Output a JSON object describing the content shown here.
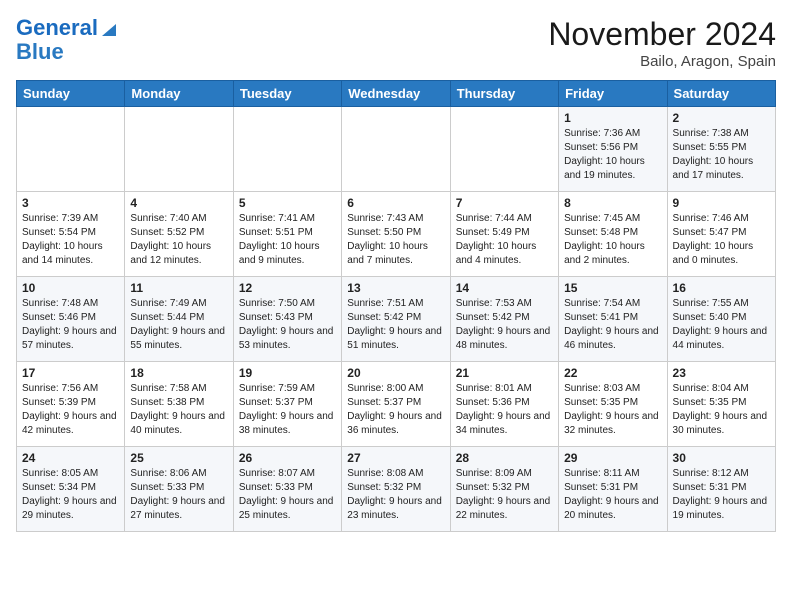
{
  "header": {
    "logo_line1": "General",
    "logo_line2": "Blue",
    "month_title": "November 2024",
    "location": "Bailo, Aragon, Spain"
  },
  "weekdays": [
    "Sunday",
    "Monday",
    "Tuesday",
    "Wednesday",
    "Thursday",
    "Friday",
    "Saturday"
  ],
  "weeks": [
    [
      {
        "day": "",
        "info": ""
      },
      {
        "day": "",
        "info": ""
      },
      {
        "day": "",
        "info": ""
      },
      {
        "day": "",
        "info": ""
      },
      {
        "day": "",
        "info": ""
      },
      {
        "day": "1",
        "info": "Sunrise: 7:36 AM\nSunset: 5:56 PM\nDaylight: 10 hours and 19 minutes."
      },
      {
        "day": "2",
        "info": "Sunrise: 7:38 AM\nSunset: 5:55 PM\nDaylight: 10 hours and 17 minutes."
      }
    ],
    [
      {
        "day": "3",
        "info": "Sunrise: 7:39 AM\nSunset: 5:54 PM\nDaylight: 10 hours and 14 minutes."
      },
      {
        "day": "4",
        "info": "Sunrise: 7:40 AM\nSunset: 5:52 PM\nDaylight: 10 hours and 12 minutes."
      },
      {
        "day": "5",
        "info": "Sunrise: 7:41 AM\nSunset: 5:51 PM\nDaylight: 10 hours and 9 minutes."
      },
      {
        "day": "6",
        "info": "Sunrise: 7:43 AM\nSunset: 5:50 PM\nDaylight: 10 hours and 7 minutes."
      },
      {
        "day": "7",
        "info": "Sunrise: 7:44 AM\nSunset: 5:49 PM\nDaylight: 10 hours and 4 minutes."
      },
      {
        "day": "8",
        "info": "Sunrise: 7:45 AM\nSunset: 5:48 PM\nDaylight: 10 hours and 2 minutes."
      },
      {
        "day": "9",
        "info": "Sunrise: 7:46 AM\nSunset: 5:47 PM\nDaylight: 10 hours and 0 minutes."
      }
    ],
    [
      {
        "day": "10",
        "info": "Sunrise: 7:48 AM\nSunset: 5:46 PM\nDaylight: 9 hours and 57 minutes."
      },
      {
        "day": "11",
        "info": "Sunrise: 7:49 AM\nSunset: 5:44 PM\nDaylight: 9 hours and 55 minutes."
      },
      {
        "day": "12",
        "info": "Sunrise: 7:50 AM\nSunset: 5:43 PM\nDaylight: 9 hours and 53 minutes."
      },
      {
        "day": "13",
        "info": "Sunrise: 7:51 AM\nSunset: 5:42 PM\nDaylight: 9 hours and 51 minutes."
      },
      {
        "day": "14",
        "info": "Sunrise: 7:53 AM\nSunset: 5:42 PM\nDaylight: 9 hours and 48 minutes."
      },
      {
        "day": "15",
        "info": "Sunrise: 7:54 AM\nSunset: 5:41 PM\nDaylight: 9 hours and 46 minutes."
      },
      {
        "day": "16",
        "info": "Sunrise: 7:55 AM\nSunset: 5:40 PM\nDaylight: 9 hours and 44 minutes."
      }
    ],
    [
      {
        "day": "17",
        "info": "Sunrise: 7:56 AM\nSunset: 5:39 PM\nDaylight: 9 hours and 42 minutes."
      },
      {
        "day": "18",
        "info": "Sunrise: 7:58 AM\nSunset: 5:38 PM\nDaylight: 9 hours and 40 minutes."
      },
      {
        "day": "19",
        "info": "Sunrise: 7:59 AM\nSunset: 5:37 PM\nDaylight: 9 hours and 38 minutes."
      },
      {
        "day": "20",
        "info": "Sunrise: 8:00 AM\nSunset: 5:37 PM\nDaylight: 9 hours and 36 minutes."
      },
      {
        "day": "21",
        "info": "Sunrise: 8:01 AM\nSunset: 5:36 PM\nDaylight: 9 hours and 34 minutes."
      },
      {
        "day": "22",
        "info": "Sunrise: 8:03 AM\nSunset: 5:35 PM\nDaylight: 9 hours and 32 minutes."
      },
      {
        "day": "23",
        "info": "Sunrise: 8:04 AM\nSunset: 5:35 PM\nDaylight: 9 hours and 30 minutes."
      }
    ],
    [
      {
        "day": "24",
        "info": "Sunrise: 8:05 AM\nSunset: 5:34 PM\nDaylight: 9 hours and 29 minutes."
      },
      {
        "day": "25",
        "info": "Sunrise: 8:06 AM\nSunset: 5:33 PM\nDaylight: 9 hours and 27 minutes."
      },
      {
        "day": "26",
        "info": "Sunrise: 8:07 AM\nSunset: 5:33 PM\nDaylight: 9 hours and 25 minutes."
      },
      {
        "day": "27",
        "info": "Sunrise: 8:08 AM\nSunset: 5:32 PM\nDaylight: 9 hours and 23 minutes."
      },
      {
        "day": "28",
        "info": "Sunrise: 8:09 AM\nSunset: 5:32 PM\nDaylight: 9 hours and 22 minutes."
      },
      {
        "day": "29",
        "info": "Sunrise: 8:11 AM\nSunset: 5:31 PM\nDaylight: 9 hours and 20 minutes."
      },
      {
        "day": "30",
        "info": "Sunrise: 8:12 AM\nSunset: 5:31 PM\nDaylight: 9 hours and 19 minutes."
      }
    ]
  ]
}
